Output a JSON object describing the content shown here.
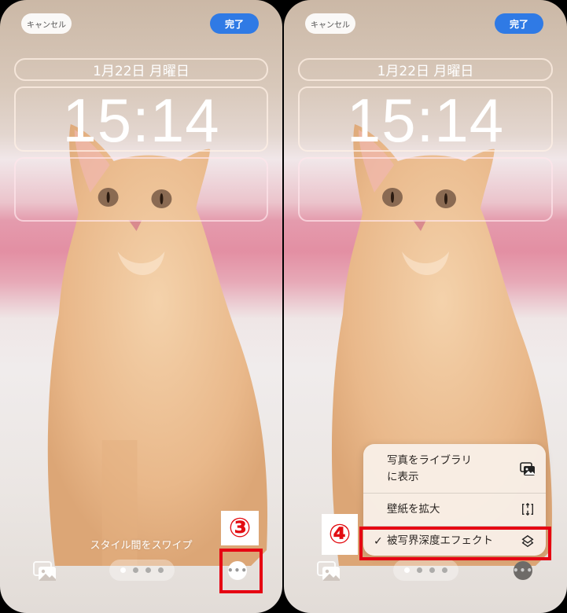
{
  "panels": [
    {
      "id": "left",
      "top_bar": {
        "cancel_label": "キャンセル",
        "done_label": "完了"
      },
      "lock_screen": {
        "date": "1月22日 月曜日",
        "time": "15:14"
      },
      "swipe_hint": "スタイル間をスワイプ",
      "page_dots": {
        "count": 4,
        "active_index": 0
      },
      "annotation": {
        "label": "③",
        "target": "more-options-button"
      }
    },
    {
      "id": "right",
      "top_bar": {
        "cancel_label": "キャンセル",
        "done_label": "完了"
      },
      "lock_screen": {
        "date": "1月22日 月曜日",
        "time": "15:14"
      },
      "page_dots": {
        "count": 4,
        "active_index": 0
      },
      "menu": {
        "items": [
          {
            "label_line1": "写真をライブラリ",
            "label_line2": "に表示",
            "icon": "photo-library-icon",
            "checked": false
          },
          {
            "label": "壁紙を拡大",
            "icon": "expand-icon",
            "checked": false
          },
          {
            "label": "被写界深度エフェクト",
            "icon": "layers-icon",
            "checked": true,
            "check_mark": "✓"
          }
        ]
      },
      "annotation": {
        "label": "④",
        "target": "depth-effect-menu-item"
      }
    }
  ],
  "colors": {
    "done_button": "#2f7ae5",
    "annotation_red": "#e60012"
  }
}
